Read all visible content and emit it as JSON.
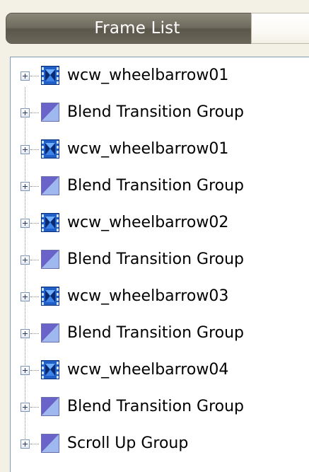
{
  "tabs": {
    "frame_list": "Frame List",
    "second_tab": ""
  },
  "tree": {
    "items": [
      {
        "label": "wcw_wheelbarrow01",
        "icon": "film-frame-icon"
      },
      {
        "label": "Blend Transition Group",
        "icon": "blend-transition-icon"
      },
      {
        "label": "wcw_wheelbarrow01",
        "icon": "film-frame-icon"
      },
      {
        "label": "Blend Transition Group",
        "icon": "blend-transition-icon"
      },
      {
        "label": "wcw_wheelbarrow02",
        "icon": "film-frame-icon"
      },
      {
        "label": "Blend Transition Group",
        "icon": "blend-transition-icon"
      },
      {
        "label": "wcw_wheelbarrow03",
        "icon": "film-frame-icon"
      },
      {
        "label": "Blend Transition Group",
        "icon": "blend-transition-icon"
      },
      {
        "label": "wcw_wheelbarrow04",
        "icon": "film-frame-icon"
      },
      {
        "label": "Blend Transition Group",
        "icon": "blend-transition-icon"
      },
      {
        "label": "Scroll Up Group",
        "icon": "blend-transition-icon"
      }
    ]
  },
  "colors": {
    "tab_active_bg": "#6e6a5d",
    "panel_border": "#7f9db9",
    "frame_icon_blue": "#1f5fc7",
    "transition_icon_purple": "#8b7bd6"
  }
}
